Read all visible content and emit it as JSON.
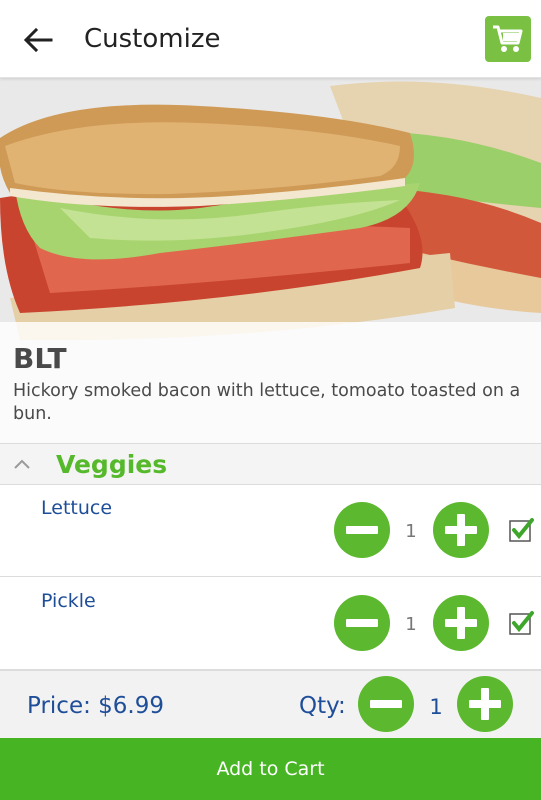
{
  "header": {
    "title": "Customize",
    "back_icon": "arrow-left-icon",
    "cart_icon": "shopping-cart-icon",
    "cart_color": "#7ac143"
  },
  "item": {
    "image": "blt-sandwich-photo",
    "name": "BLT",
    "description": "Hickory smoked bacon with lettuce, tomoato toasted on a bun."
  },
  "section": {
    "title": "Veggies",
    "collapse_icon": "chevron-up-icon",
    "accent_color": "#56b82b",
    "options": [
      {
        "label": "Lettuce",
        "qty": "1",
        "checked": true
      },
      {
        "label": "Pickle",
        "qty": "1",
        "checked": true
      }
    ]
  },
  "footer": {
    "price": "Price: $6.99",
    "qty_label": "Qty:",
    "qty": "1",
    "add_to_cart": "Add to Cart",
    "button_color": "#47b523"
  }
}
